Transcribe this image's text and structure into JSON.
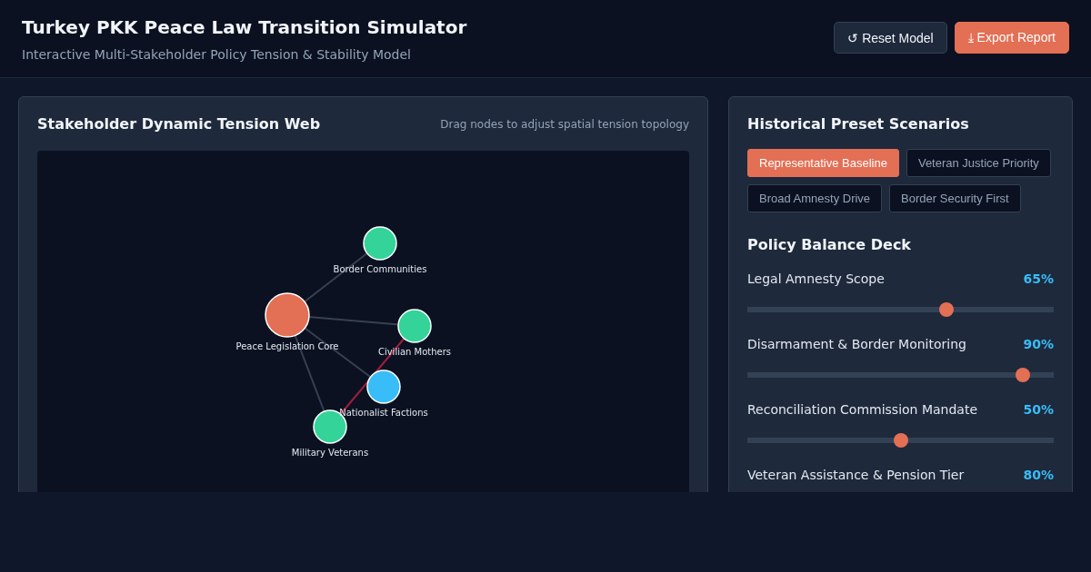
{
  "header": {
    "title": "Turkey PKK Peace Law Transition Simulator",
    "subtitle": "Interactive Multi-Stakeholder Policy Tension & Stability Model",
    "buttons": [
      {
        "label": "↺ Reset Model",
        "kind": "secondary"
      },
      {
        "label": "⤓ Export Report",
        "kind": "primary"
      }
    ]
  },
  "tension_web": {
    "title": "Stakeholder Dynamic Tension Web",
    "hint": "Drag nodes to adjust spatial tension topology",
    "nodes": [
      {
        "label": "Border Communities",
        "color": "#34d399",
        "kind": "stakeholder"
      },
      {
        "label": "Peace Legislation Core",
        "color": "#e36f55",
        "kind": "core"
      },
      {
        "label": "Civilian Mothers",
        "color": "#34d399",
        "kind": "stakeholder"
      },
      {
        "label": "Nationalist Factions",
        "color": "#38bdf8",
        "kind": "stakeholder"
      },
      {
        "label": "Military Veterans",
        "color": "#34d399",
        "kind": "stakeholder"
      }
    ],
    "edges": [
      {
        "kind": "link"
      },
      {
        "kind": "link"
      },
      {
        "kind": "link"
      },
      {
        "kind": "link"
      },
      {
        "kind": "conflict"
      }
    ]
  },
  "scenarios": {
    "title": "Historical Preset Scenarios",
    "presets": [
      {
        "label": "Representative Baseline",
        "selected": true
      },
      {
        "label": "Veteran Justice Priority",
        "selected": false
      },
      {
        "label": "Broad Amnesty Drive",
        "selected": false
      },
      {
        "label": "Border Security First",
        "selected": false
      }
    ]
  },
  "policy_deck": {
    "title": "Policy Balance Deck",
    "sliders": [
      {
        "name": "Legal Amnesty Scope",
        "level": 0.65,
        "reading": "65%"
      },
      {
        "name": "Disarmament & Border Monitoring",
        "level": 0.9,
        "reading": "90%"
      },
      {
        "name": "Reconciliation Commission Mandate",
        "level": 0.5,
        "reading": "50%"
      },
      {
        "name": "Veteran Assistance & Pension Tier",
        "reading": "80%"
      }
    ]
  }
}
